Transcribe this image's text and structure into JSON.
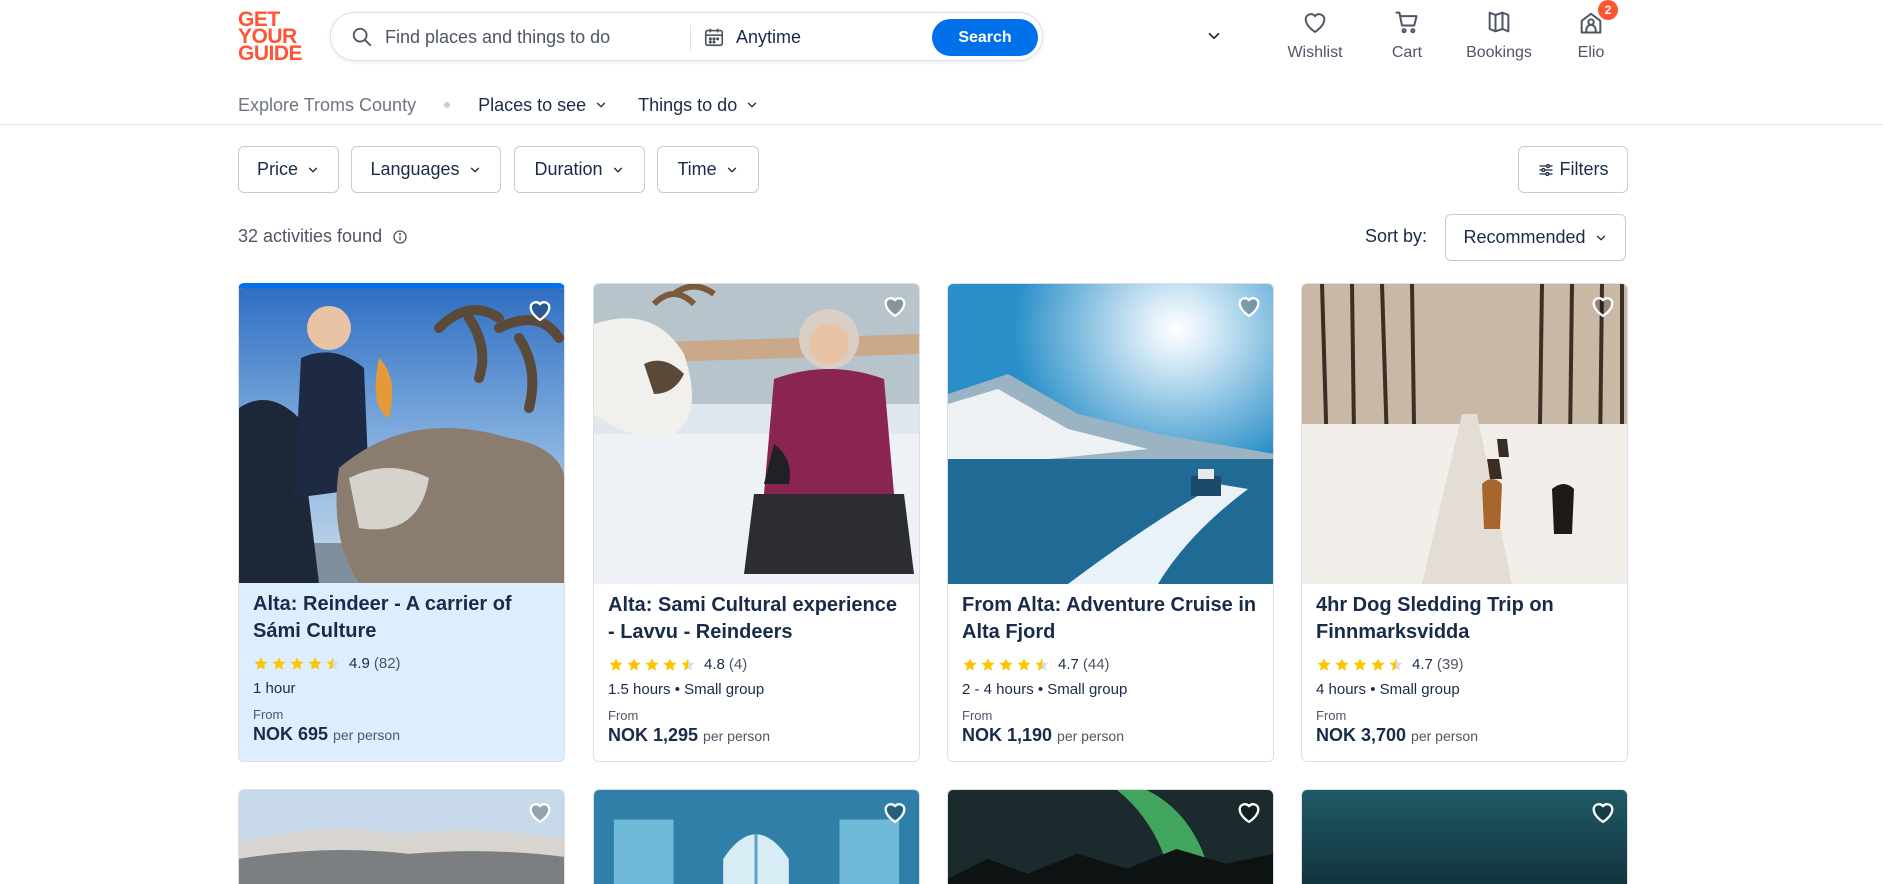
{
  "brand": {
    "line1": "GET",
    "line2": "YOUR",
    "line3": "GUIDE",
    "color": "#ff5533"
  },
  "search": {
    "placeholder": "Find places and things to do",
    "date_label": "Anytime",
    "button_label": "Search"
  },
  "nav": {
    "wishlist": "Wishlist",
    "cart": "Cart",
    "bookings": "Bookings",
    "profile": "Elio",
    "profile_badge": "2"
  },
  "subnav": {
    "explore": "Explore Troms County",
    "places": "Places to see",
    "things": "Things to do"
  },
  "filters": {
    "price": "Price",
    "languages": "Languages",
    "duration": "Duration",
    "time": "Time",
    "all": "Filters"
  },
  "results": {
    "count": "32 activities found",
    "sort_label": "Sort by:",
    "sort_value": "Recommended"
  },
  "cards": [
    {
      "title": "Alta: Reindeer - A carrier of Sámi Culture",
      "rating": 4.9,
      "rating_text": "4.9",
      "reviews": "(82)",
      "meta": "1 hour",
      "from": "From",
      "price": "NOK 695",
      "per": "per person"
    },
    {
      "title": "Alta: Sami Cultural experience - Lavvu - Reindeers",
      "rating": 4.8,
      "rating_text": "4.8",
      "reviews": "(4)",
      "meta": "1.5 hours • Small group",
      "from": "From",
      "price": "NOK 1,295",
      "per": "per person"
    },
    {
      "title": "From Alta: Adventure Cruise in Alta Fjord",
      "rating": 4.7,
      "rating_text": "4.7",
      "reviews": "(44)",
      "meta": "2 - 4 hours • Small group",
      "from": "From",
      "price": "NOK 1,190",
      "per": "per person"
    },
    {
      "title": "4hr Dog Sledding Trip on Finnmarksvidda",
      "rating": 4.7,
      "rating_text": "4.7",
      "reviews": "(39)",
      "meta": "4 hours • Small group",
      "from": "From",
      "price": "NOK 3,700",
      "per": "per person"
    }
  ],
  "colors": {
    "accent": "#0071eb",
    "star": "#fdc500",
    "text": "#1a2b49",
    "highlight": "#ddeeff"
  }
}
